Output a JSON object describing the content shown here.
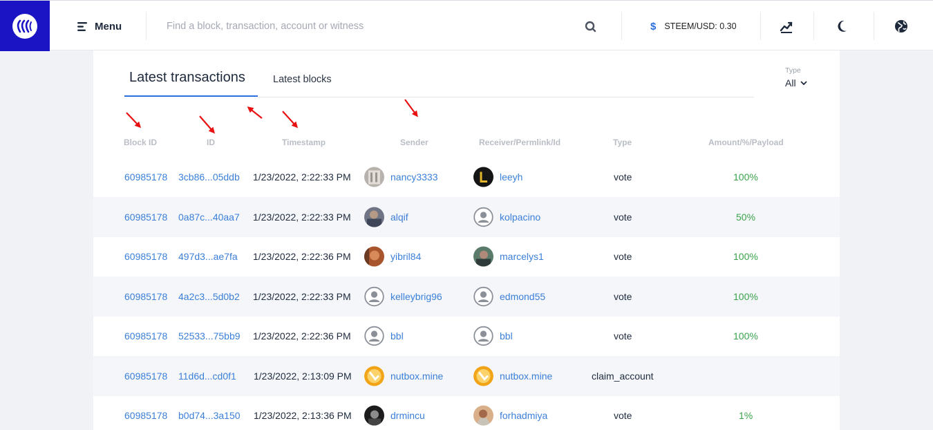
{
  "topbar": {
    "menu_label": "Menu",
    "search_placeholder": "Find a block, transaction, account or witness",
    "price_label": "STEEM/USD: 0.30",
    "currency_symbol": "$"
  },
  "tabs": {
    "active": "Latest transactions",
    "second": "Latest blocks"
  },
  "type_filter": {
    "label": "Type",
    "value": "All"
  },
  "columns": [
    "Block ID",
    "ID",
    "Timestamp",
    "Sender",
    "Receiver/Permlink/Id",
    "Type",
    "Amount/%/Payload"
  ],
  "rows": [
    {
      "block": "60985178",
      "id": "3cb86...05ddb",
      "ts": "1/23/2022, 2:22:33 PM",
      "sender": "nancy3333",
      "receiver": "leeyh",
      "type": "vote",
      "amount": "100%"
    },
    {
      "block": "60985178",
      "id": "0a87c...40aa7",
      "ts": "1/23/2022, 2:22:33 PM",
      "sender": "alqif",
      "receiver": "kolpacino",
      "type": "vote",
      "amount": "50%"
    },
    {
      "block": "60985178",
      "id": "497d3...ae7fa",
      "ts": "1/23/2022, 2:22:36 PM",
      "sender": "yibril84",
      "receiver": "marcelys1",
      "type": "vote",
      "amount": "100%"
    },
    {
      "block": "60985178",
      "id": "4a2c3...5d0b2",
      "ts": "1/23/2022, 2:22:33 PM",
      "sender": "kelleybrig96",
      "receiver": "edmond55",
      "type": "vote",
      "amount": "100%"
    },
    {
      "block": "60985178",
      "id": "52533...75bb9",
      "ts": "1/23/2022, 2:22:36 PM",
      "sender": "bbl",
      "receiver": "bbl",
      "type": "vote",
      "amount": "100%"
    },
    {
      "block": "60985178",
      "id": "11d6d...cd0f1",
      "ts": "1/23/2022, 2:13:09 PM",
      "sender": "nutbox.mine",
      "receiver": "nutbox.mine",
      "type": "claim_account",
      "amount": ""
    },
    {
      "block": "60985178",
      "id": "b0d74...3a150",
      "ts": "1/23/2022, 2:13:36 PM",
      "sender": "drmincu",
      "receiver": "forhadmiya",
      "type": "vote",
      "amount": "1%"
    }
  ],
  "colors": {
    "brand": "#1a14c4",
    "link": "#3b7fd9",
    "positive": "#3aa34a",
    "annotation_arrow": "#e81010"
  }
}
